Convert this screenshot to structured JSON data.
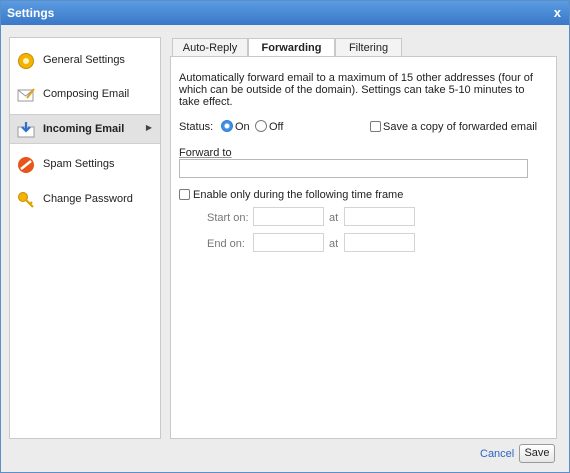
{
  "window": {
    "title": "Settings",
    "close_label": "x"
  },
  "sidebar": {
    "items": [
      {
        "label": "General Settings",
        "icon": "gear-icon"
      },
      {
        "label": "Composing Email",
        "icon": "compose-icon"
      },
      {
        "label": "Incoming Email",
        "icon": "download-icon",
        "active": true
      },
      {
        "label": "Spam Settings",
        "icon": "no-entry-icon"
      },
      {
        "label": "Change Password",
        "icon": "key-icon"
      }
    ]
  },
  "tabs": [
    {
      "label": "Auto-Reply"
    },
    {
      "label": "Forwarding",
      "active": true
    },
    {
      "label": "Filtering"
    }
  ],
  "forwarding": {
    "description": "Automatically forward email to a maximum of 15 other addresses (four of which can be outside of the domain). Settings can take 5-10 minutes to take effect.",
    "status_label": "Status:",
    "on_label": "On",
    "off_label": "Off",
    "status": "On",
    "save_copy_label": "Save a copy of forwarded email",
    "save_copy_checked": false,
    "forward_to_label": "Forward to",
    "forward_to_value": "",
    "timeframe_label": "Enable only during the following time frame",
    "timeframe_checked": false,
    "start_label": "Start on:",
    "end_label": "End on:",
    "at_label": "at",
    "start_date": "",
    "start_time": "",
    "end_date": "",
    "end_time": ""
  },
  "footer": {
    "cancel_label": "Cancel",
    "save_label": "Save"
  },
  "colors": {
    "accent": "#3a78c9",
    "radio_on": "#3e8fe6",
    "link": "#2b66c4"
  }
}
